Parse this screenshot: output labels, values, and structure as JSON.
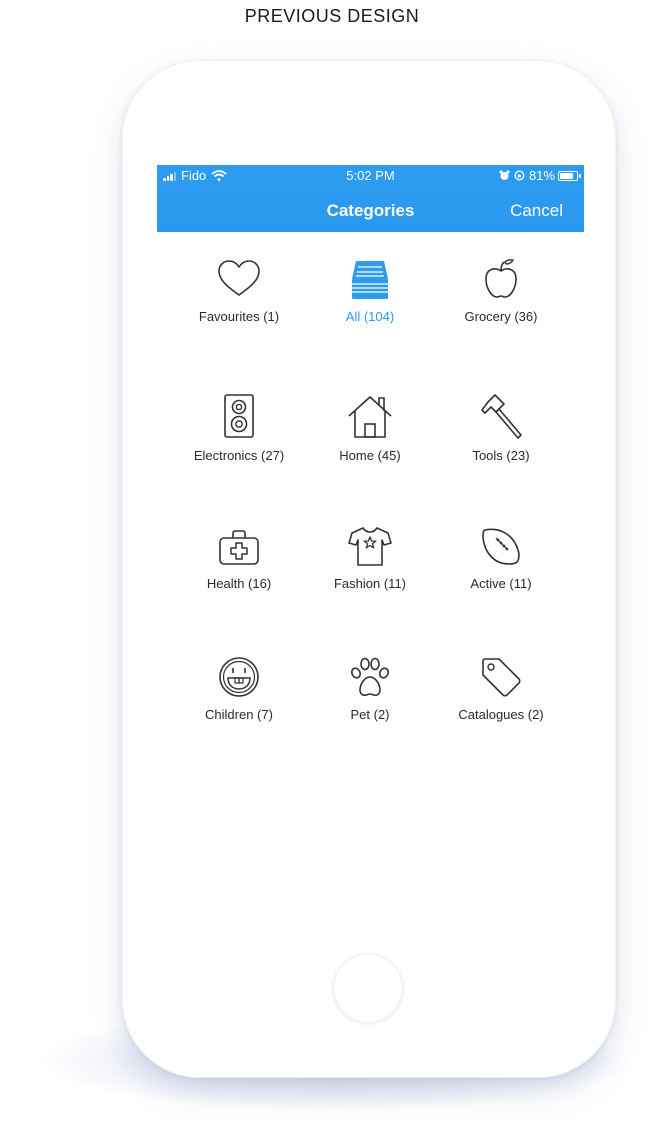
{
  "caption": "PREVIOUS DESIGN",
  "status_bar": {
    "carrier": "Fido",
    "time": "5:02 PM",
    "battery": "81%"
  },
  "nav": {
    "title": "Categories",
    "cancel_label": "Cancel"
  },
  "accent_color": "#2d9cf0",
  "categories": [
    {
      "label": "Favourites (1)",
      "icon": "heart-icon",
      "selected": false
    },
    {
      "label": "All (104)",
      "icon": "stack-icon",
      "selected": true
    },
    {
      "label": "Grocery (36)",
      "icon": "apple-icon",
      "selected": false
    },
    {
      "label": "Electronics (27)",
      "icon": "speaker-icon",
      "selected": false
    },
    {
      "label": "Home (45)",
      "icon": "house-icon",
      "selected": false
    },
    {
      "label": "Tools (23)",
      "icon": "hammer-icon",
      "selected": false
    },
    {
      "label": "Health (16)",
      "icon": "first-aid-kit-icon",
      "selected": false
    },
    {
      "label": "Fashion (11)",
      "icon": "t-shirt-icon",
      "selected": false
    },
    {
      "label": "Active (11)",
      "icon": "football-icon",
      "selected": false
    },
    {
      "label": "Children (7)",
      "icon": "smiley-face-icon",
      "selected": false
    },
    {
      "label": "Pet (2)",
      "icon": "paw-icon",
      "selected": false
    },
    {
      "label": "Catalogues (2)",
      "icon": "tag-icon",
      "selected": false
    }
  ]
}
